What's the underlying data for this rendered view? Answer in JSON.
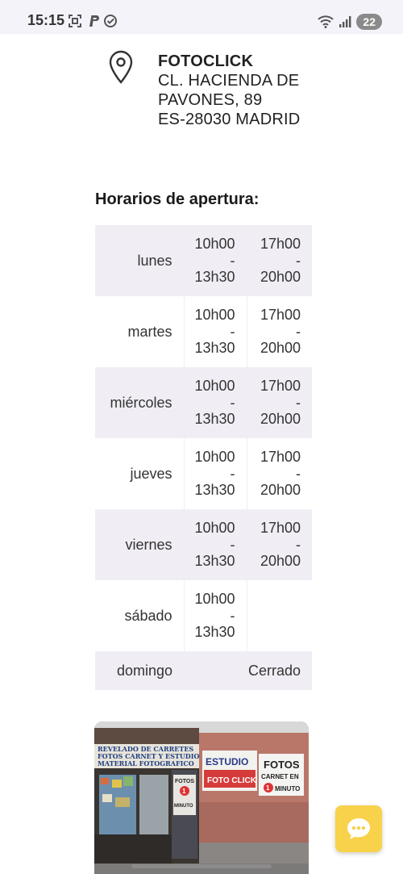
{
  "status_bar": {
    "time": "15:15",
    "battery": "22",
    "icons": [
      "screenshot-icon",
      "paypal-icon",
      "check-circle-icon",
      "wifi-icon",
      "signal-icon"
    ]
  },
  "address": {
    "name": "FOTOCLICK",
    "street_1": "CL. HACIENDA DE",
    "street_2": "PAVONES, 89",
    "city": "ES-28030 MADRID",
    "icon": "location-pin-icon"
  },
  "hours": {
    "title": "Horarios de apertura:",
    "rows": [
      {
        "day": "lunes",
        "s1_open": "10h00",
        "s1_sep": "-",
        "s1_close": "13h30",
        "s2_open": "17h00",
        "s2_sep": "-",
        "s2_close": "20h00"
      },
      {
        "day": "martes",
        "s1_open": "10h00",
        "s1_sep": "-",
        "s1_close": "13h30",
        "s2_open": "17h00",
        "s2_sep": "-",
        "s2_close": "20h00"
      },
      {
        "day": "miércoles",
        "s1_open": "10h00",
        "s1_sep": "-",
        "s1_close": "13h30",
        "s2_open": "17h00",
        "s2_sep": "-",
        "s2_close": "20h00"
      },
      {
        "day": "jueves",
        "s1_open": "10h00",
        "s1_sep": "-",
        "s1_close": "13h30",
        "s2_open": "17h00",
        "s2_sep": "-",
        "s2_close": "20h00"
      },
      {
        "day": "viernes",
        "s1_open": "10h00",
        "s1_sep": "-",
        "s1_close": "13h30",
        "s2_open": "17h00",
        "s2_sep": "-",
        "s2_close": "20h00"
      },
      {
        "day": "sábado",
        "s1_open": "10h00",
        "s1_sep": "-",
        "s1_close": "13h30"
      }
    ],
    "closed_day": "domingo",
    "closed_label": "Cerrado"
  },
  "store_photo": {
    "sign_estudio": "ESTUDIO",
    "sign_fotoclick": "FOTO CLICK",
    "sign_fotos": "FOTOS",
    "sign_carnet": "CARNET EN",
    "sign_minuto": "MINUTO",
    "sign_banner_1": "REVELADO DE CARRETES",
    "sign_banner_2": "FOTOS CARNET Y ESTUDIO",
    "sign_banner_3": "MATERIAL FOTOGRAFICO",
    "sign_num": "1"
  },
  "chat": {
    "icon": "chat-bubble-icon"
  }
}
